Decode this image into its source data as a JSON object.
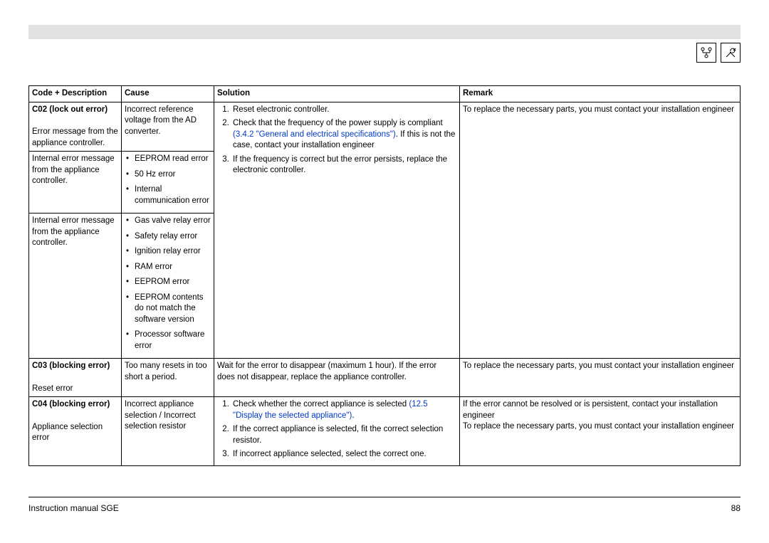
{
  "header": {
    "icon1_name": "diagram-icon",
    "icon2_name": "tools-icon"
  },
  "table": {
    "headers": {
      "code": "Code + Description",
      "cause": "Cause",
      "solution": "Solution",
      "remark": "Remark"
    },
    "r1": {
      "code_title": "C02 (lock out error)",
      "code_sub1": "Error message from the appliance controller.",
      "cause1": "Incorrect reference voltage from the AD converter.",
      "sol_1": "Reset electronic controller.",
      "sol_2a": "Check that the frequency of the power supply is compliant ",
      "sol_2link": "(3.4.2 \"General and electrical specifications\")",
      "sol_2b": ". If this is not the case, contact your installation engineer",
      "sol_3": "If the frequency is correct but the error persists, replace the electronic controller.",
      "remark": "To replace the necessary parts, you must contact your installation engineer",
      "code_sub2": "Internal error message from the appliance controller.",
      "cause2_b1": "EEPROM read error",
      "cause2_b2": "50 Hz error",
      "cause2_b3": "Internal communication error",
      "code_sub3": "Internal error message from the appliance controller.",
      "cause3_b1": "Gas valve relay error",
      "cause3_b2": "Safety relay error",
      "cause3_b3": "Ignition relay error",
      "cause3_b4": "RAM error",
      "cause3_b5": "EEPROM error",
      "cause3_b6": "EEPROM contents do not match the software version",
      "cause3_b7": "Processor software error"
    },
    "r2": {
      "code_title": "C03 (blocking error)",
      "code_sub": "Reset error",
      "cause": "Too many resets in too short a period.",
      "solution": "Wait for the error to disappear (maximum 1 hour). If the error does not disappear, replace the appliance controller.",
      "remark": "To replace the necessary parts, you must contact your installation engineer"
    },
    "r3": {
      "code_title": "C04 (blocking error)",
      "code_sub": "Appliance selection error",
      "cause": "Incorrect appliance selection / Incorrect selection resistor",
      "sol_1a": "Check whether the correct appliance is selected ",
      "sol_1link": "(12.5 \"Display the selected appliance\")",
      "sol_1b": ".",
      "sol_2": "If the correct appliance is selected, fit the correct selection resistor.",
      "sol_3": "If incorrect appliance selected, select the correct one.",
      "remark1": "If the error cannot be resolved or is persistent, contact your installation engineer",
      "remark2": "To replace the necessary parts, you must contact your installation engineer"
    }
  },
  "footer": {
    "left": "Instruction manual SGE",
    "right": "88"
  }
}
